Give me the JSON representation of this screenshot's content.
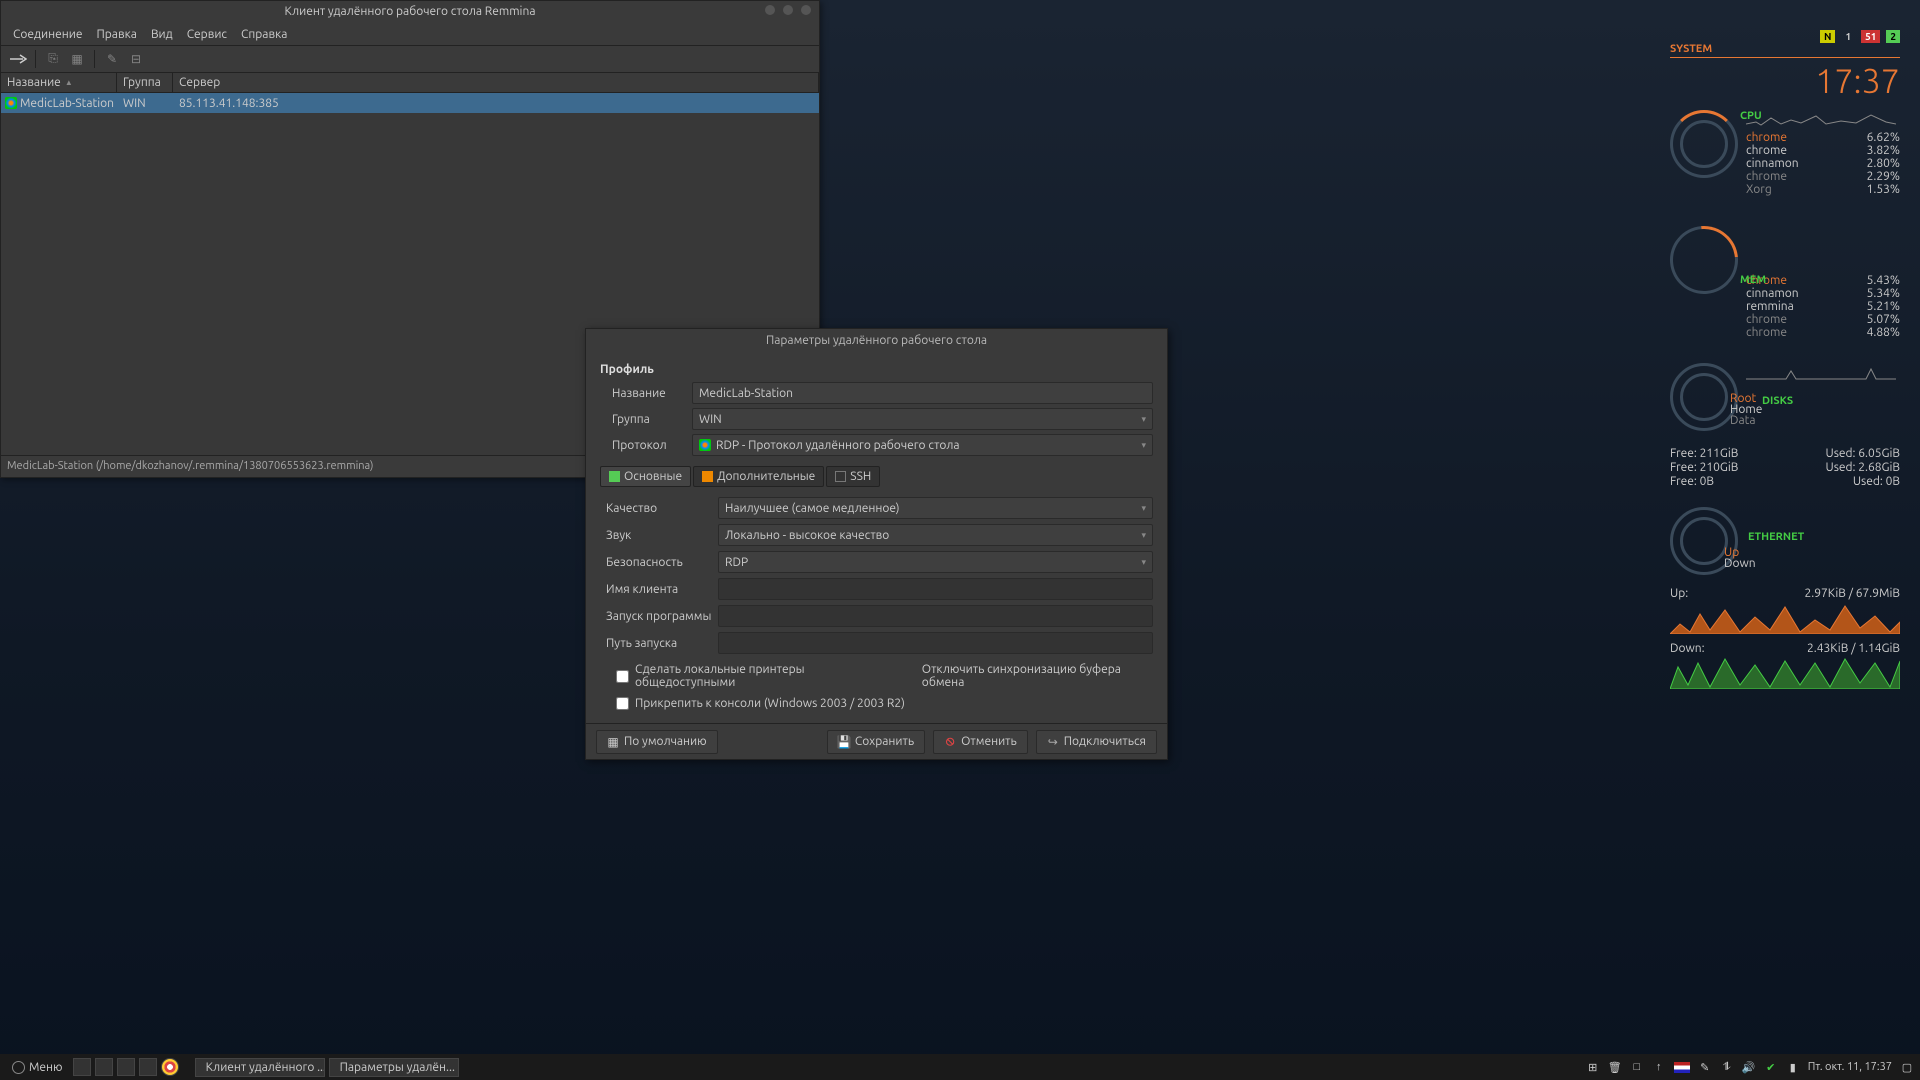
{
  "remmina": {
    "title": "Клиент удалённого рабочего стола Remmina",
    "menu": {
      "connection": "Соединение",
      "edit": "Правка",
      "view": "Вид",
      "service": "Сервис",
      "help": "Справка"
    },
    "cols": {
      "name": "Название",
      "group": "Группа",
      "server": "Сервер"
    },
    "row": {
      "name": "MedicLab-Station",
      "group": "WIN",
      "server": "85.113.41.148:385"
    },
    "status": "MedicLab-Station (/home/dkozhanov/.remmina/1380706553623.remmina)"
  },
  "dialog": {
    "title": "Параметры удалённого рабочего стола",
    "section": "Профиль",
    "labels": {
      "name": "Название",
      "group": "Группа",
      "protocol": "Протокол"
    },
    "values": {
      "name": "MedicLab-Station",
      "group": "WIN",
      "protocol": "RDP - Протокол удалённого рабочего стола"
    },
    "tabs": {
      "basic": "Основные",
      "extra": "Дополнительные",
      "ssh": "SSH"
    },
    "opts": {
      "quality_l": "Качество",
      "quality_v": "Наилучшее (самое медленное)",
      "sound_l": "Звук",
      "sound_v": "Локально - высокое качество",
      "security_l": "Безопасность",
      "security_v": "RDP",
      "client_l": "Имя клиента",
      "client_v": "",
      "startprog_l": "Запуск программы",
      "startprog_v": "",
      "startpath_l": "Путь запуска",
      "startpath_v": ""
    },
    "checks": {
      "printers": "Сделать локальные принтеры общедоступными",
      "clipboard": "Отключить синхронизацию буфера обмена",
      "console": "Прикрепить к консоли (Windows 2003 / 2003 R2)"
    },
    "buttons": {
      "default": "По умолчанию",
      "save": "Сохранить",
      "cancel": "Отменить",
      "connect": "Подключиться"
    }
  },
  "conky": {
    "system": "SYSTEM",
    "tags": {
      "n": "N",
      "one": "1",
      "fiftyone": "51",
      "two": "2"
    },
    "clock": "17:37",
    "cpu": {
      "title": "CPU",
      "procs": [
        {
          "n": "chrome",
          "v": "6.62%",
          "c": "orange"
        },
        {
          "n": "chrome",
          "v": "3.82%",
          "c": ""
        },
        {
          "n": "cinnamon",
          "v": "2.80%",
          "c": ""
        },
        {
          "n": "chrome",
          "v": "2.29%",
          "c": "dim"
        },
        {
          "n": "Xorg",
          "v": "1.53%",
          "c": "dim"
        }
      ]
    },
    "mem": {
      "title": "MEM",
      "procs": [
        {
          "n": "chrome",
          "v": "5.43%",
          "c": "orange"
        },
        {
          "n": "cinnamon",
          "v": "5.34%",
          "c": ""
        },
        {
          "n": "remmina",
          "v": "5.21%",
          "c": ""
        },
        {
          "n": "chrome",
          "v": "5.07%",
          "c": "dim"
        },
        {
          "n": "chrome",
          "v": "4.88%",
          "c": "dim"
        }
      ]
    },
    "disks": {
      "title": "DISKS",
      "labels": {
        "root": "Root",
        "home": "Home",
        "data": "Data"
      },
      "rows": [
        {
          "l": "Free: 211GiB",
          "r": "Used: 6.05GiB"
        },
        {
          "l": "Free: 210GiB",
          "r": "Used: 2.68GiB"
        },
        {
          "l": "Free: 0B",
          "r": "Used: 0B"
        }
      ]
    },
    "eth": {
      "title": "ETHERNET",
      "up": "Up",
      "down": "Down",
      "uprow": {
        "l": "Up:",
        "r": "2.97KiB / 67.9MiB"
      },
      "dnrow": {
        "l": "Down:",
        "r": "2.43KiB / 1.14GiB"
      }
    }
  },
  "taskbar": {
    "menu": "Меню",
    "task1": "Клиент удалённого ...",
    "task2": "Параметры удалён...",
    "clock": "Пт. окт. 11, 17:37"
  }
}
